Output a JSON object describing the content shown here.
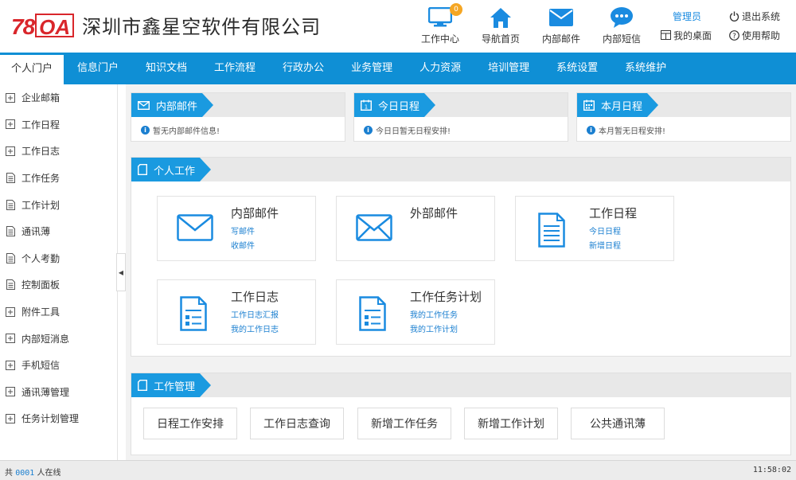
{
  "logo": {
    "num": "78",
    "oa": "OA"
  },
  "company_name": "深圳市鑫星空软件有限公司",
  "top_nav": [
    {
      "label": "工作中心",
      "icon": "monitor-icon",
      "badge": "0"
    },
    {
      "label": "导航首页",
      "icon": "home-icon"
    },
    {
      "label": "内部邮件",
      "icon": "mail-icon"
    },
    {
      "label": "内部短信",
      "icon": "chat-icon"
    }
  ],
  "user_links": {
    "admin": "管理员",
    "logout": "退出系统",
    "desktop": "我的桌面",
    "help": "使用帮助"
  },
  "menu": [
    "个人门户",
    "信息门户",
    "知识文档",
    "工作流程",
    "行政办公",
    "业务管理",
    "人力资源",
    "培训管理",
    "系统设置",
    "系统维护"
  ],
  "sidebar": [
    {
      "label": "企业邮箱",
      "icon": "plus-box-icon"
    },
    {
      "label": "工作日程",
      "icon": "plus-box-icon"
    },
    {
      "label": "工作日志",
      "icon": "plus-box-icon"
    },
    {
      "label": "工作任务",
      "icon": "doc-icon"
    },
    {
      "label": "工作计划",
      "icon": "doc-icon"
    },
    {
      "label": "通讯薄",
      "icon": "doc-icon"
    },
    {
      "label": "个人考勤",
      "icon": "doc-icon"
    },
    {
      "label": "控制面板",
      "icon": "doc-icon"
    },
    {
      "label": "附件工具",
      "icon": "plus-box-icon"
    },
    {
      "label": "内部短消息",
      "icon": "plus-box-icon"
    },
    {
      "label": "手机短信",
      "icon": "plus-box-icon"
    },
    {
      "label": "通讯薄管理",
      "icon": "plus-box-icon"
    },
    {
      "label": "任务计划管理",
      "icon": "plus-box-icon"
    }
  ],
  "panels": {
    "mail": {
      "title": "内部邮件",
      "msg": "暂无内部邮件信息!"
    },
    "today": {
      "title": "今日日程",
      "msg": "今日日暂无日程安排!"
    },
    "month": {
      "title": "本月日程",
      "msg": "本月暂无日程安排!"
    },
    "personal": {
      "title": "个人工作"
    },
    "manage": {
      "title": "工作管理"
    }
  },
  "cards": [
    {
      "title": "内部邮件",
      "links": [
        "写邮件",
        "收邮件"
      ],
      "icon": "envelope-icon"
    },
    {
      "title": "外部邮件",
      "links": [],
      "icon": "envelope-open-icon"
    },
    {
      "title": "工作日程",
      "links": [
        "今日日程",
        "新增日程"
      ],
      "icon": "document-icon"
    },
    {
      "title": "工作日志",
      "links": [
        "工作日志汇报",
        "我的工作日志"
      ],
      "icon": "form-icon"
    },
    {
      "title": "工作任务计划",
      "links": [
        "我的工作任务",
        "我的工作计划"
      ],
      "icon": "form-icon"
    }
  ],
  "manage_buttons": [
    "日程工作安排",
    "工作日志查询",
    "新增工作任务",
    "新增工作计划",
    "公共通讯薄"
  ],
  "status": {
    "prefix": "共",
    "count": "0001",
    "suffix": "人在线",
    "time": "11:58:02"
  },
  "colors": {
    "brand_blue": "#0f8fd5",
    "tag_blue": "#1a9ae0",
    "logo_red": "#d9262b",
    "badge_orange": "#f5a623"
  }
}
